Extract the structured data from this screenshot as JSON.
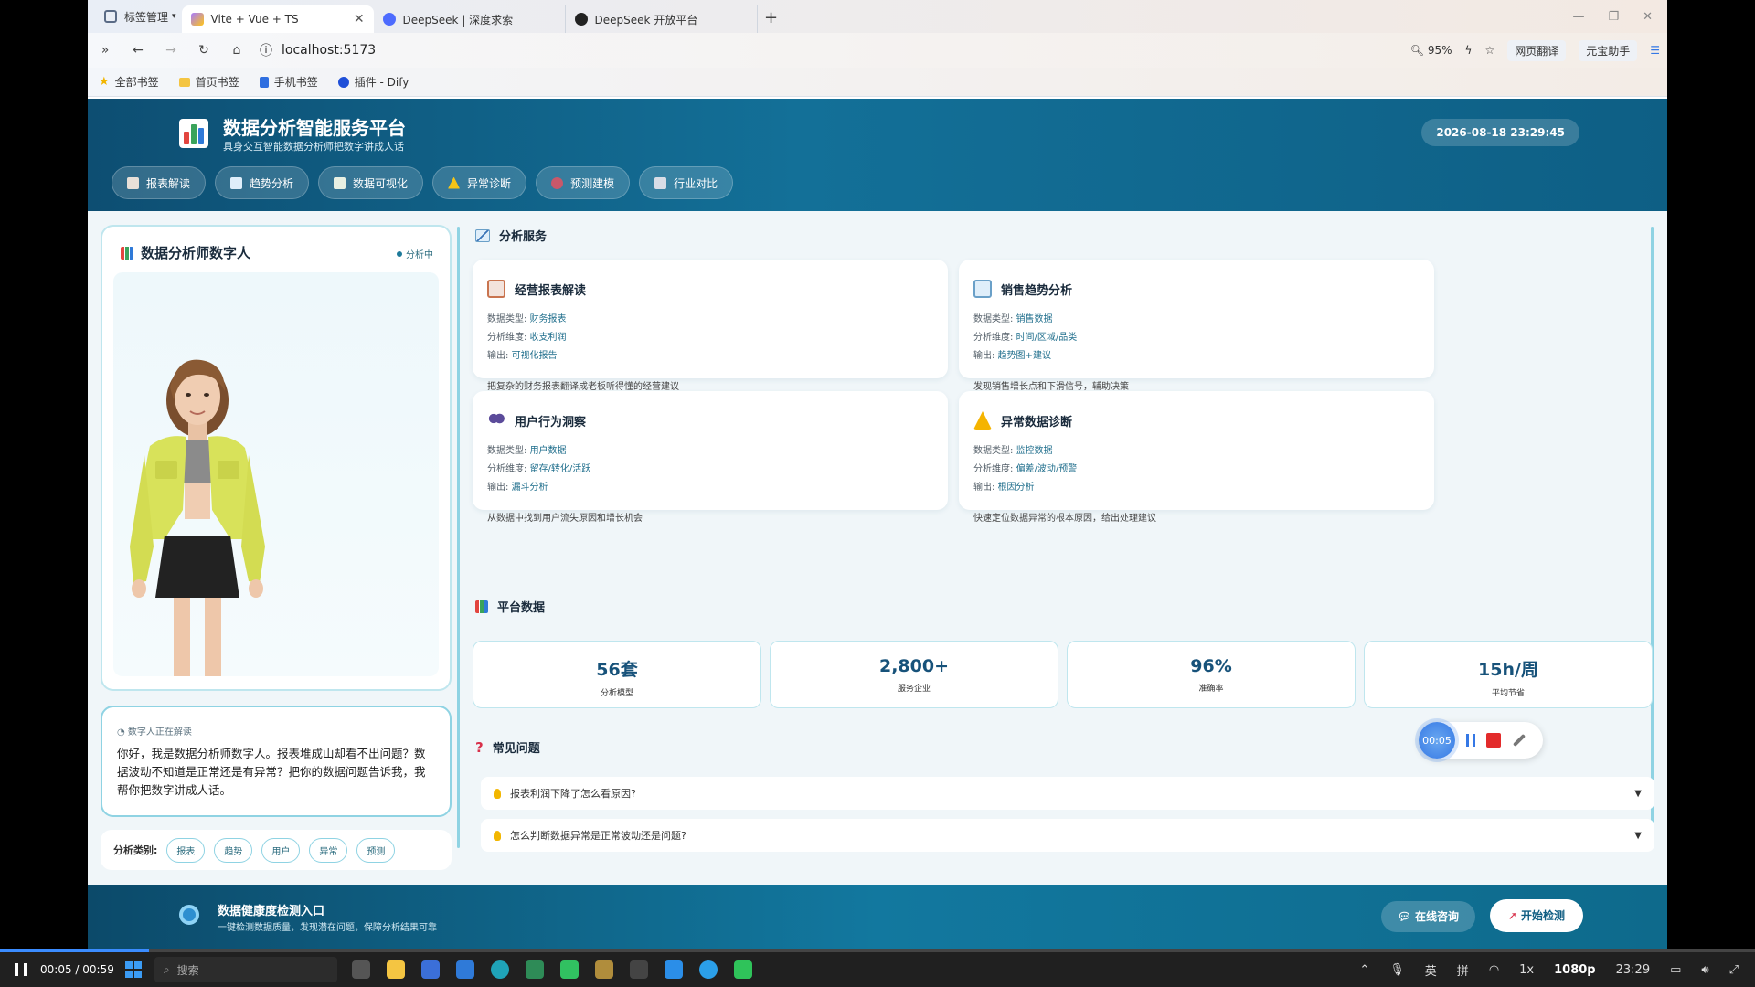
{
  "browser": {
    "tab_group_label": "标签管理",
    "tabs": [
      {
        "title": "Vite + Vue + TS",
        "active": true
      },
      {
        "title": "DeepSeek | 深度求索",
        "active": false
      },
      {
        "title": "DeepSeek 开放平台",
        "active": false
      }
    ],
    "url": "localhost:5173",
    "zoom": "95%",
    "translate_label": "网页翻译",
    "assistant_label": "元宝助手",
    "bookmarks": [
      "全部书签",
      "首页书签",
      "手机书签",
      "插件 - Dify"
    ]
  },
  "header": {
    "title": "数据分析智能服务平台",
    "subtitle": "具身交互智能数据分析师把数字讲成人话",
    "datetime": "2026-08-18 23:29:45",
    "nav": [
      {
        "label": "报表解读",
        "color": "#e8e0d8"
      },
      {
        "label": "趋势分析",
        "color": "#dfeefa"
      },
      {
        "label": "数据可视化",
        "color": "#e7f0e3"
      },
      {
        "label": "异常诊断",
        "color": "#f5c518"
      },
      {
        "label": "预测建模",
        "color": "#c9586a"
      },
      {
        "label": "行业对比",
        "color": "#d8dde6"
      }
    ]
  },
  "avatar": {
    "title": "数据分析师数字人",
    "status": "分析中",
    "speaking_hint": "数字人正在解读",
    "speech": "你好，我是数据分析师数字人。报表堆成山却看不出问题？数据波动不知道是正常还是有异常？把你的数据问题告诉我，我帮你把数字讲成人话。",
    "category_label": "分析类别:",
    "categories": [
      "报表",
      "趋势",
      "用户",
      "异常",
      "预测"
    ]
  },
  "services": {
    "section_title": "分析服务",
    "field_labels": {
      "type": "数据类型:",
      "dimension": "分析维度:",
      "output": "输出:"
    },
    "cards": [
      {
        "title": "经营报表解读",
        "icon": "clipboard-icon",
        "type": "财务报表",
        "dimension": "收支利润",
        "output": "可视化报告",
        "desc": "把复杂的财务报表翻译成老板听得懂的经营建议"
      },
      {
        "title": "销售趋势分析",
        "icon": "trend-chart-icon",
        "type": "销售数据",
        "dimension": "时间/区域/品类",
        "output": "趋势图+建议",
        "desc": "发现销售增长点和下滑信号，辅助决策"
      },
      {
        "title": "用户行为洞察",
        "icon": "users-icon",
        "type": "用户数据",
        "dimension": "留存/转化/活跃",
        "output": "漏斗分析",
        "desc": "从数据中找到用户流失原因和增长机会"
      },
      {
        "title": "异常数据诊断",
        "icon": "warning-icon",
        "type": "监控数据",
        "dimension": "偏差/波动/预警",
        "output": "根因分析",
        "desc": "快速定位数据异常的根本原因，给出处理建议"
      }
    ]
  },
  "stats": {
    "section_title": "平台数据",
    "items": [
      {
        "value": "56套",
        "label": "分析模型"
      },
      {
        "value": "2,800+",
        "label": "服务企业"
      },
      {
        "value": "96%",
        "label": "准确率"
      },
      {
        "value": "15h/周",
        "label": "平均节省"
      }
    ]
  },
  "faq": {
    "section_title": "常见问题",
    "items": [
      {
        "q": "报表利润下降了怎么看原因?"
      },
      {
        "q": "怎么判断数据异常是正常波动还是问题?"
      }
    ]
  },
  "recorder": {
    "timer": "00:05"
  },
  "footer": {
    "title": "数据健康度检测入口",
    "subtitle": "一键检测数据质量，发现潜在问题，保障分析结果可靠",
    "consult_label": "在线咨询",
    "start_label": "开始检测"
  },
  "player": {
    "time": "00:05 / 00:59",
    "progress": 0.085,
    "search_placeholder": "搜索",
    "lang": "英",
    "ime": "拼",
    "resolution": "1080p",
    "speed": "1x",
    "clock": "23:29"
  }
}
